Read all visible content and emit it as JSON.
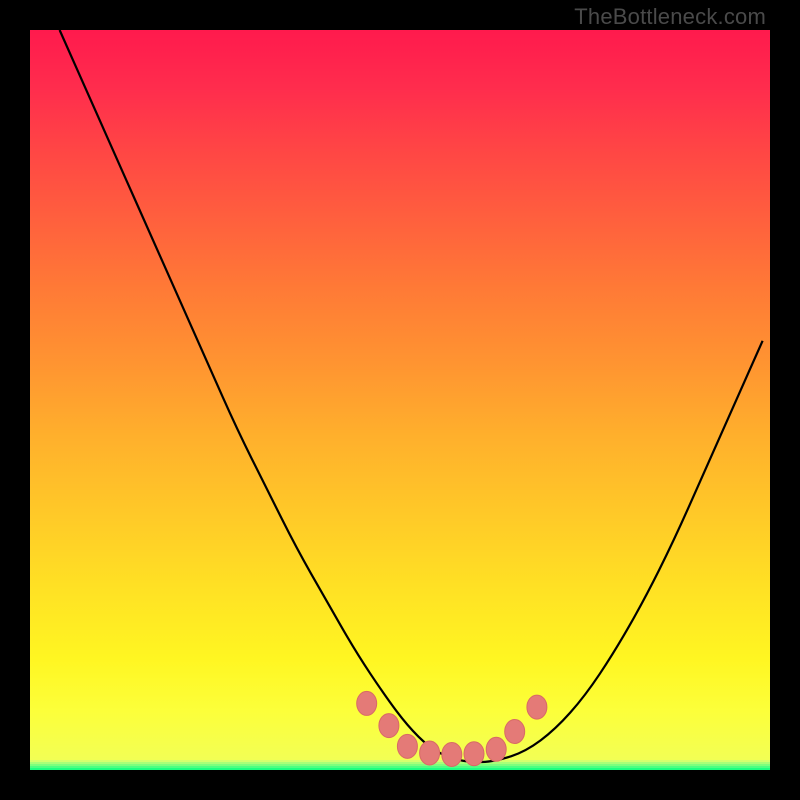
{
  "watermark": "TheBottleneck.com",
  "chart_data": {
    "type": "line",
    "title": "",
    "xlabel": "",
    "ylabel": "",
    "xlim": [
      0,
      100
    ],
    "ylim": [
      0,
      100
    ],
    "grid": false,
    "legend": false,
    "series": [
      {
        "name": "bottleneck-curve",
        "x": [
          4,
          8,
          12,
          16,
          20,
          24,
          28,
          32,
          36,
          40,
          44,
          48,
          51,
          54,
          57,
          60,
          63,
          67,
          71,
          75,
          79,
          83,
          87,
          91,
          95,
          99
        ],
        "y": [
          100,
          91,
          82,
          73,
          64,
          55,
          46,
          38,
          30,
          23,
          16,
          10,
          6,
          3,
          1.5,
          1,
          1.2,
          2.5,
          5.5,
          10,
          16,
          23,
          31,
          40,
          49,
          58
        ]
      }
    ],
    "markers": {
      "name": "highlight-dots",
      "x": [
        45.5,
        48.5,
        51,
        54,
        57,
        60,
        63,
        65.5,
        68.5
      ],
      "y": [
        9,
        6,
        3.2,
        2.3,
        2.1,
        2.2,
        2.8,
        5.2,
        8.5
      ]
    },
    "gradient_stops": [
      {
        "pos": 0,
        "color": "#ff1a4d"
      },
      {
        "pos": 50,
        "color": "#ffb02c"
      },
      {
        "pos": 95,
        "color": "#f0ff5a"
      },
      {
        "pos": 100,
        "color": "#1cff80"
      }
    ]
  }
}
